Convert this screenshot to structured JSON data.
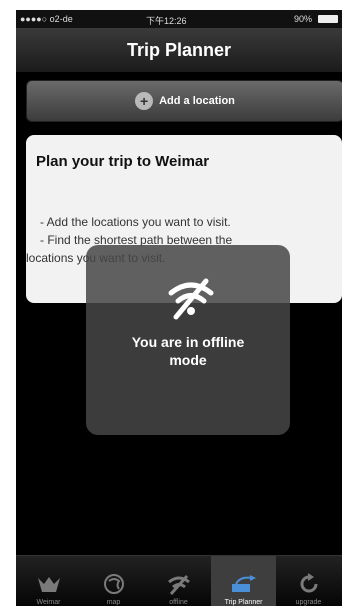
{
  "statusbar": {
    "carrier": "●●●●○ o2-de",
    "time": "下午12:26",
    "battery_pct": "90%"
  },
  "navbar": {
    "title": "Trip Planner"
  },
  "add_location": {
    "label": "Add a location"
  },
  "card": {
    "title": "Plan your trip to Weimar",
    "line1": "- Add the locations you want to visit.",
    "line2": "- Find the shortest path between the",
    "line3": "locations you want to visit."
  },
  "offline": {
    "line1": "You are in offline",
    "line2": "mode"
  },
  "tabs": [
    {
      "label": "Weimar",
      "icon": "weimar-icon"
    },
    {
      "label": "map",
      "icon": "globe-icon"
    },
    {
      "label": "offline",
      "icon": "no-wifi-icon"
    },
    {
      "label": "Trip Planner",
      "icon": "trip-planner-icon"
    },
    {
      "label": "upgrade",
      "icon": "refresh-icon"
    }
  ],
  "colors": {
    "background": "#000000",
    "accent_tab": "#3e3e3e",
    "overlay": "#464646"
  }
}
